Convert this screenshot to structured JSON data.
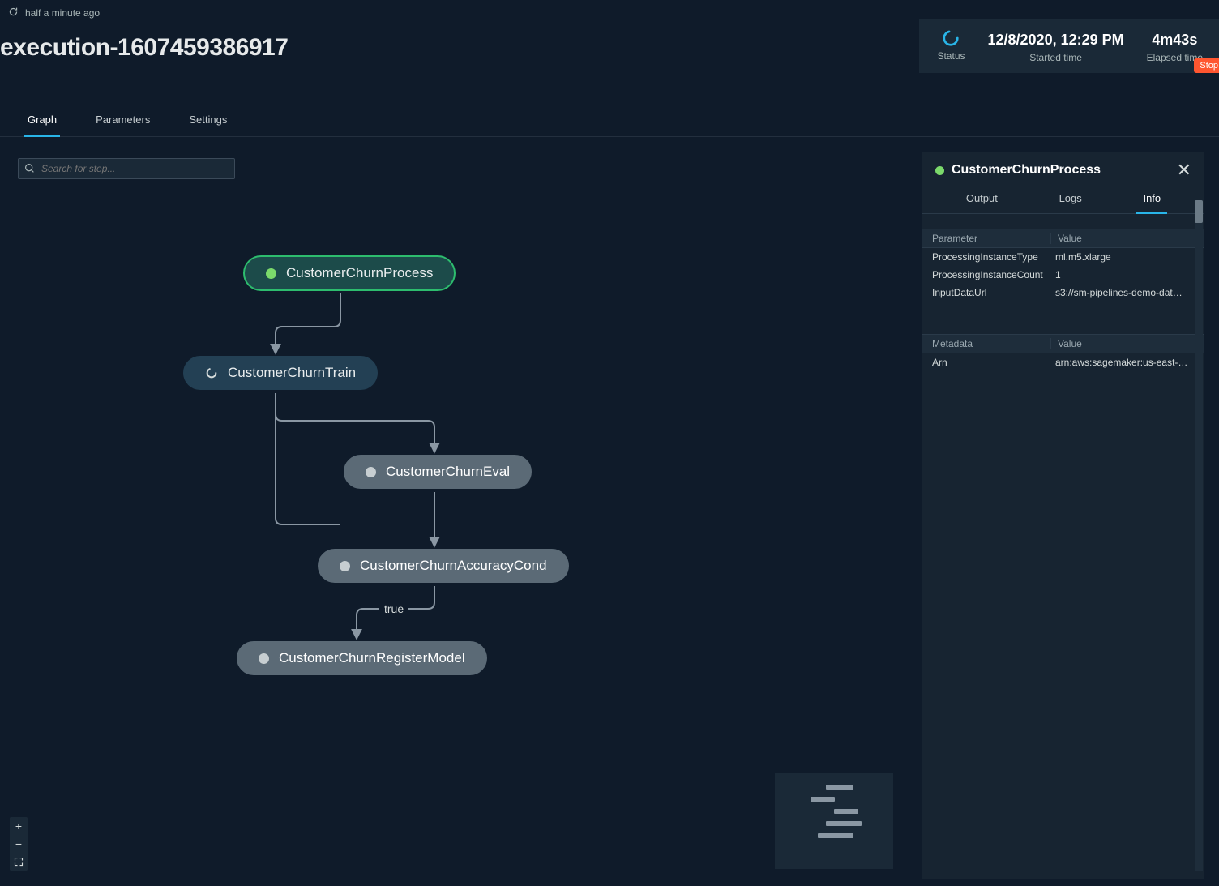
{
  "header": {
    "refresh_icon": "refresh-icon",
    "last_refresh": "half a minute ago",
    "title": "execution-1607459386917"
  },
  "status_card": {
    "status_label": "Status",
    "started_time": "12/8/2020, 12:29 PM",
    "started_time_label": "Started time",
    "elapsed_time": "4m43s",
    "elapsed_time_label": "Elapsed time",
    "stop_label": "Stop"
  },
  "primary_tabs": {
    "items": [
      "Graph",
      "Parameters",
      "Settings"
    ],
    "active_index": 0
  },
  "search": {
    "placeholder": "Search for step..."
  },
  "nodes": [
    {
      "id": "n1",
      "label": "CustomerChurnProcess",
      "state": "complete"
    },
    {
      "id": "n2",
      "label": "CustomerChurnTrain",
      "state": "running"
    },
    {
      "id": "n3",
      "label": "CustomerChurnEval",
      "state": "pending"
    },
    {
      "id": "n4",
      "label": "CustomerChurnAccuracyCond",
      "state": "pending"
    },
    {
      "id": "n5",
      "label": "CustomerChurnRegisterModel",
      "state": "pending"
    }
  ],
  "edges": [
    {
      "from": "n1",
      "to": "n2"
    },
    {
      "from": "n2",
      "to": "n3"
    },
    {
      "from": "n2",
      "to": "n4"
    },
    {
      "from": "n3",
      "to": "n4"
    },
    {
      "from": "n4",
      "to": "n5",
      "label": "true"
    }
  ],
  "details": {
    "title": "CustomerChurnProcess",
    "status_color": "#7bd96b",
    "tabs": [
      "Output",
      "Logs",
      "Info"
    ],
    "active_tab_index": 2,
    "param_header_key": "Parameter",
    "param_header_val": "Value",
    "params": [
      {
        "k": "ProcessingInstanceType",
        "v": "ml.m5.xlarge"
      },
      {
        "k": "ProcessingInstanceCount",
        "v": "1"
      },
      {
        "k": "InputDataUrl",
        "v": "s3://sm-pipelines-demo-dat…"
      }
    ],
    "meta_header_key": "Metadata",
    "meta_header_val": "Value",
    "metadata": [
      {
        "k": "Arn",
        "v": "arn:aws:sagemaker:us-east-…"
      }
    ]
  },
  "zoom": {
    "in": "+",
    "out": "−"
  },
  "colors": {
    "accent": "#29b5e8",
    "success": "#7bd96b",
    "danger": "#ff5630",
    "bg": "#0f1b2a",
    "panel": "#172431"
  }
}
